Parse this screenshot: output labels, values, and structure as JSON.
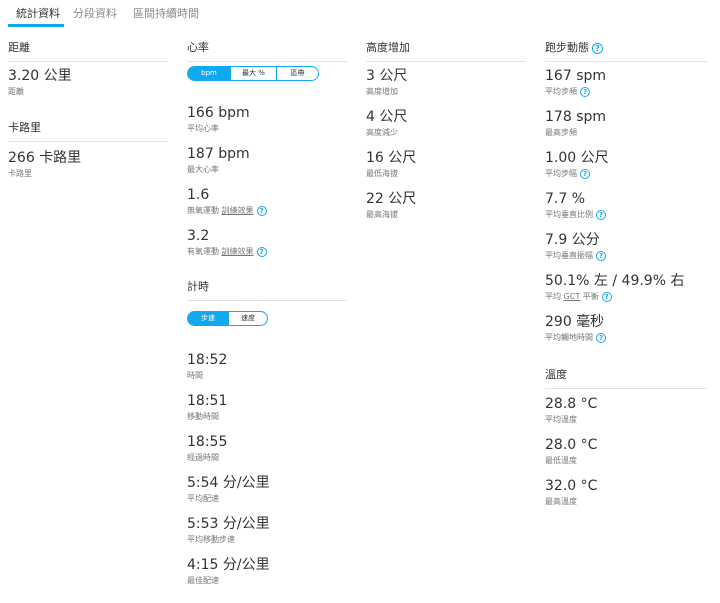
{
  "tabs": [
    {
      "label": "統計資料",
      "active": true
    },
    {
      "label": "分段資料",
      "active": false
    },
    {
      "label": "區間持續時間",
      "active": false
    }
  ],
  "colors": {
    "accent": "#11a9ed",
    "divider": "#e4e4e4",
    "label": "#777777"
  },
  "distance": {
    "title": "距離",
    "value": "3.20",
    "unit": "公里",
    "label": "距離"
  },
  "calories": {
    "title": "卡路里",
    "value": "266",
    "unit": "卡路里",
    "label": "卡路里"
  },
  "heart_rate": {
    "title": "心率",
    "toggle": [
      "bpm",
      "最大 %",
      "區帶"
    ],
    "avg": {
      "value": "166",
      "unit": "bpm",
      "label": "平均心率"
    },
    "max": {
      "value": "187",
      "unit": "bpm",
      "label": "最大心率"
    },
    "anaerobic": {
      "value": "1.6",
      "label_pre": "無氧運動",
      "label_link": "訓練效果"
    },
    "aerobic": {
      "value": "3.2",
      "label_pre": "有氧運動",
      "label_link": "訓練效果"
    }
  },
  "timing": {
    "title": "計時",
    "toggle": [
      "步速",
      "速度"
    ],
    "time": {
      "value": "18:52",
      "label": "時間"
    },
    "moving_time": {
      "value": "18:51",
      "label": "移動時間"
    },
    "elapsed_time": {
      "value": "18:55",
      "label": "經過時間"
    },
    "avg_pace": {
      "value": "5:54",
      "unit": "分/公里",
      "label": "平均配速"
    },
    "avg_moving_pace": {
      "value": "5:53",
      "unit": "分/公里",
      "label": "平均移動步速"
    },
    "best_pace": {
      "value": "4:15",
      "unit": "分/公里",
      "label": "最佳配速"
    }
  },
  "elevation": {
    "title": "高度增加",
    "gain": {
      "value": "3",
      "unit": "公尺",
      "label": "高度增加"
    },
    "loss": {
      "value": "4",
      "unit": "公尺",
      "label": "高度減少"
    },
    "min": {
      "value": "16",
      "unit": "公尺",
      "label": "最低海拔"
    },
    "max": {
      "value": "22",
      "unit": "公尺",
      "label": "最高海拔"
    }
  },
  "running_dynamics": {
    "title": "跑步動態",
    "avg_cadence": {
      "value": "167",
      "unit": "spm",
      "label": "平均步頻"
    },
    "max_cadence": {
      "value": "178",
      "unit": "spm",
      "label": "最高步頻"
    },
    "avg_stride": {
      "value": "1.00",
      "unit": "公尺",
      "label": "平均步幅"
    },
    "vertical_ratio": {
      "value": "7.7",
      "unit": "%",
      "label": "平均垂直比例"
    },
    "vertical_oscillation": {
      "value": "7.9",
      "unit": "公分",
      "label": "平均垂直振幅"
    },
    "gct_balance": {
      "value": "50.1% 左 / 49.9% 右",
      "label_pre": "平均",
      "label_abbr": "GCT",
      "label_post": "平衡"
    },
    "ground_contact": {
      "value": "290",
      "unit": "毫秒",
      "label": "平均觸地時間"
    }
  },
  "temperature": {
    "title": "溫度",
    "avg": {
      "value": "28.8",
      "unit": "°C",
      "label": "平均溫度"
    },
    "min": {
      "value": "28.0",
      "unit": "°C",
      "label": "最低溫度"
    },
    "max": {
      "value": "32.0",
      "unit": "°C",
      "label": "最高溫度"
    }
  }
}
